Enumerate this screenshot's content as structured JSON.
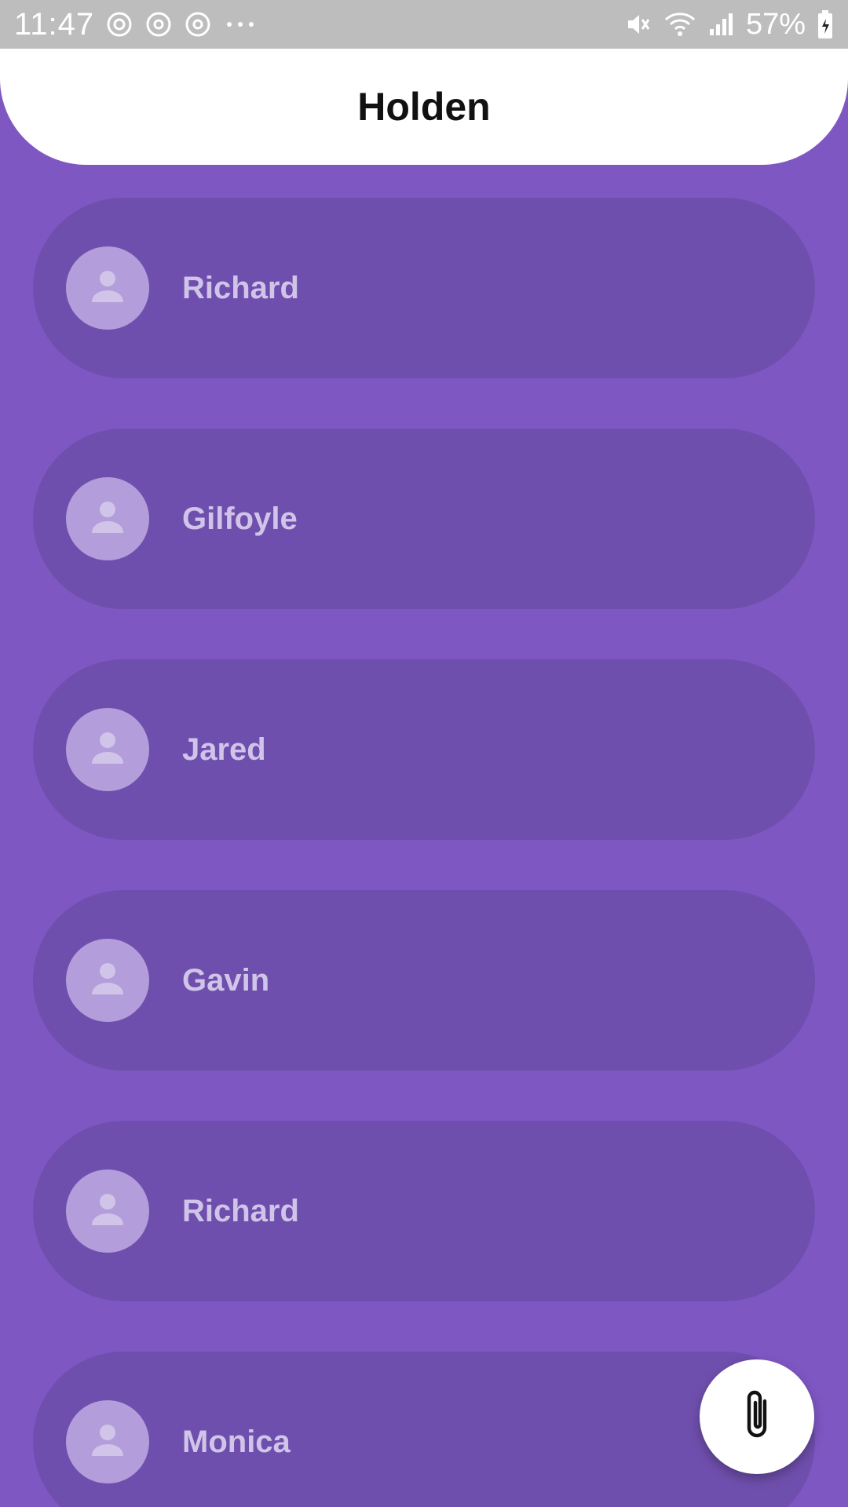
{
  "status_bar": {
    "time": "11:47",
    "battery": "57%",
    "icons": [
      "sync-icon",
      "chrome-icon",
      "chrome-icon",
      "more-notifications-icon",
      "mute-icon",
      "wifi-icon",
      "signal-icon",
      "battery-charging-icon"
    ]
  },
  "header": {
    "title": "Holden"
  },
  "contacts": [
    {
      "name": "Richard",
      "icon": "person-icon"
    },
    {
      "name": "Gilfoyle",
      "icon": "person-icon"
    },
    {
      "name": "Jared",
      "icon": "person-icon"
    },
    {
      "name": "Gavin",
      "icon": "person-icon"
    },
    {
      "name": "Richard",
      "icon": "person-icon"
    },
    {
      "name": "Monica",
      "icon": "person-icon"
    }
  ],
  "fab": {
    "icon": "paperclip-icon"
  },
  "colors": {
    "background": "#7e57c2",
    "card": "#6f4fad",
    "avatar": "#b39ddb",
    "name_text": "#d1c4e9",
    "header_bg": "#ffffff",
    "status_bar": "#bdbdbd"
  }
}
